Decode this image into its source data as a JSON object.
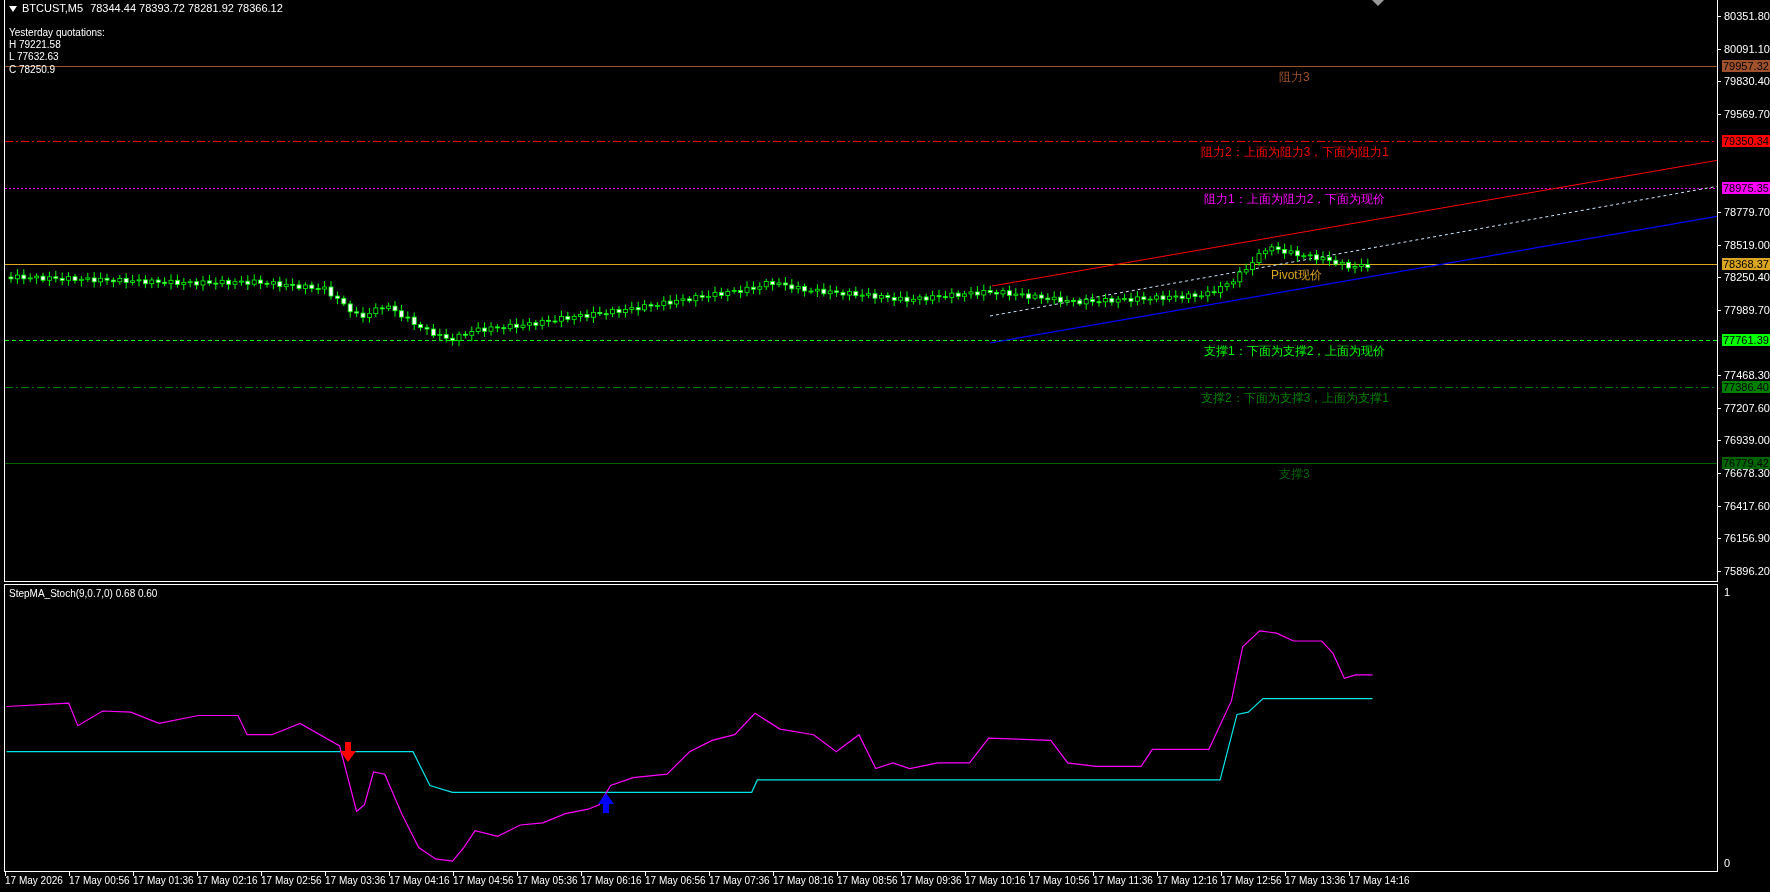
{
  "chart_header": {
    "symbol": "BTCUST,M5",
    "ohlc": "78344.44 78393.72 78281.92 78366.12"
  },
  "yesterday": {
    "title": "Yesterday quotations:",
    "high": "H 79221.58",
    "low": "L 77632.63",
    "close": "C 78250.9"
  },
  "levels": [
    {
      "label": "阻力3",
      "price_tag": "79957.32",
      "color": "#a0522d",
      "kind": "solid"
    },
    {
      "label": "阻力2：上面为阻力3，下面为阻力1",
      "price_tag": "79350.34",
      "color": "#ff0000",
      "kind": "dashdot"
    },
    {
      "label": "阻力1：上面为阻力2，下面为现价",
      "price_tag": "78975.35",
      "color": "#ff00ff",
      "kind": "dot"
    },
    {
      "label": "Pivot现价",
      "price_tag": "78368.37",
      "color": "#daa520",
      "kind": "solid"
    },
    {
      "label": "支撑1：下面为支撑2，上面为现价",
      "price_tag": "77761.39",
      "color": "#00ff00",
      "kind": "dash"
    },
    {
      "label": "支撑2：下面为支撑3，上面为支撑1",
      "price_tag": "77386.40",
      "color": "#008000",
      "kind": "dashdot"
    },
    {
      "label": "支撑3",
      "price_tag": "76779.42",
      "color": "#006400",
      "kind": "solid"
    }
  ],
  "price_axis": {
    "ticks": [
      "80351.80",
      "80091.10",
      "79830.40",
      "79569.70",
      "78779.70",
      "78519.00",
      "78250.40",
      "77989.70",
      "77468.30",
      "77207.60",
      "76939.00",
      "76678.30",
      "76417.60",
      "76156.90",
      "75896.20"
    ]
  },
  "indicator": {
    "title": "StepMA_Stoch(9,0.7,0) 0.68 0.60",
    "scale": [
      "1",
      "0"
    ]
  },
  "time_axis": {
    "labels": [
      "17 May 2026",
      "17 May 00:56",
      "17 May 01:36",
      "17 May 02:16",
      "17 May 02:56",
      "17 May 03:36",
      "17 May 04:16",
      "17 May 04:56",
      "17 May 05:36",
      "17 May 06:16",
      "17 May 06:56",
      "17 May 07:36",
      "17 May 08:16",
      "17 May 08:56",
      "17 May 09:36",
      "17 May 10:16",
      "17 May 10:56",
      "17 May 11:36",
      "17 May 12:16",
      "17 May 12:56",
      "17 May 13:36",
      "17 May 14:16"
    ]
  }
}
